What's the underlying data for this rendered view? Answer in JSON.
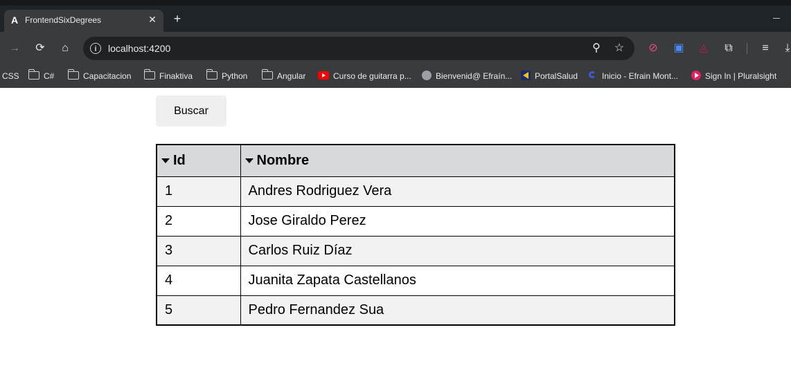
{
  "browser": {
    "tab": {
      "title": "FrontendSixDegrees",
      "favicon": "A",
      "close": "✕"
    },
    "new_tab": "+",
    "address": {
      "url": "localhost:4200"
    },
    "bookmarks": [
      {
        "label": "CSS",
        "icon": "none"
      },
      {
        "label": "C#",
        "icon": "folder-icon"
      },
      {
        "label": "Capacitacion",
        "icon": "folder-icon"
      },
      {
        "label": "Finaktiva",
        "icon": "folder-icon"
      },
      {
        "label": "Python",
        "icon": "folder-icon"
      },
      {
        "label": "Angular",
        "icon": "folder-icon"
      },
      {
        "label": "Curso de guitarra p...",
        "icon": "youtube-icon"
      },
      {
        "label": "Bienvenid@ Efraín...",
        "icon": "globe-icon"
      },
      {
        "label": "PortalSalud",
        "icon": "portalsalud-icon"
      },
      {
        "label": "Inicio - Efrain Mont...",
        "icon": "inicio-icon"
      },
      {
        "label": "Sign In | Pluralsight",
        "icon": "pluralsight-icon"
      }
    ]
  },
  "page": {
    "search_button": "Buscar",
    "table": {
      "columns": [
        "Id",
        "Nombre"
      ],
      "rows": [
        [
          "1",
          "Andres Rodriguez Vera"
        ],
        [
          "2",
          "Jose Giraldo Perez"
        ],
        [
          "3",
          "Carlos Ruiz Díaz"
        ],
        [
          "4",
          "Juanita Zapata Castellanos"
        ],
        [
          "5",
          "Pedro Fernandez Sua"
        ]
      ]
    }
  }
}
